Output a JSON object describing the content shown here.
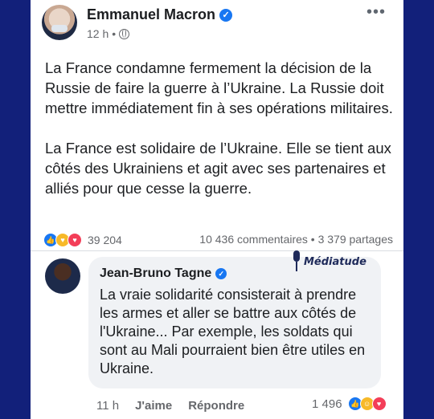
{
  "post": {
    "author": "Emmanuel Macron",
    "time": "12 h",
    "visibility_sep": "•",
    "more": "•••",
    "paragraphs": [
      "La France condamne fermement la décision de la Russie de faire la guerre à l’Ukraine. La Russie doit mettre immédiatement fin à ses opérations militaires.",
      "La France est solidaire de l’Ukraine. Elle se tient aux côtés des Ukrainiens et agit avec ses partenaires et alliés pour que cesse la guerre."
    ],
    "reaction_count": "39 204",
    "comments_shares": "10 436 commentaires • 3 379 partages",
    "icons": [
      "verified-badge-icon",
      "globe-icon",
      "more-options-icon",
      "like-reaction-icon",
      "care-reaction-icon",
      "love-reaction-icon"
    ]
  },
  "comment": {
    "author": "Jean-Bruno Tagne",
    "text": "La vraie solidarité consisterait à prendre les armes et aller se battre aux côtés de l'Ukraine... Par exemple, les soldats qui sont au Mali pourraient bien être utiles en Ukraine.",
    "time": "11 h",
    "like_label": "J'aime",
    "reply_label": "Répondre",
    "reaction_count": "1 496",
    "icons": [
      "verified-badge-icon",
      "like-reaction-icon",
      "haha-reaction-icon",
      "love-reaction-icon"
    ]
  },
  "watermark": {
    "text": "Médiatude",
    "icon": "microphone-icon"
  },
  "colors": {
    "page_background": "#12207a",
    "brand_blue": "#1877f2",
    "secondary_text": "#65676b",
    "comment_bubble": "#f0f2f5"
  }
}
